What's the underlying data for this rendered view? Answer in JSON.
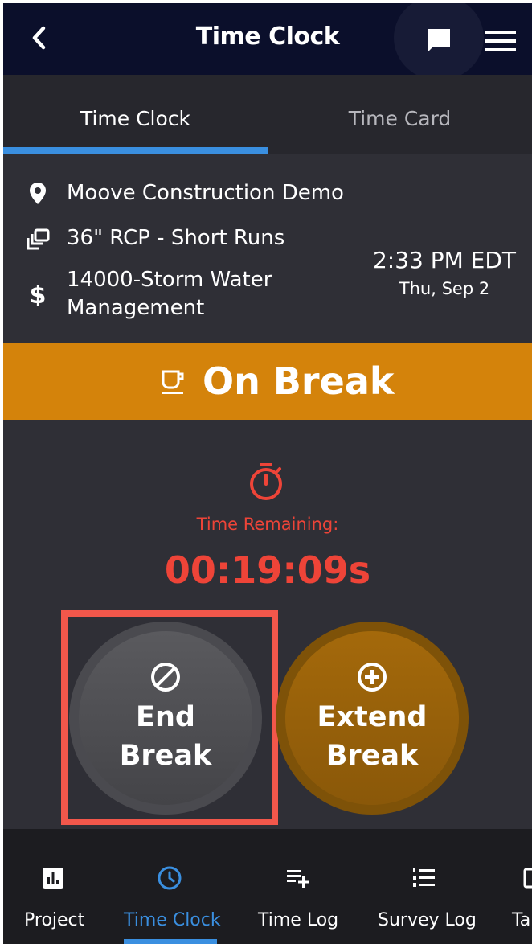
{
  "header": {
    "title": "Time Clock",
    "back_icon": "chevron-left-icon",
    "chat_icon": "chat-icon",
    "menu_icon": "hamburger-menu-icon"
  },
  "tabs": [
    {
      "label": "Time Clock",
      "active": true
    },
    {
      "label": "Time Card",
      "active": false
    }
  ],
  "info": {
    "project": "Moove Construction Demo",
    "task": "36\" RCP - Short Runs",
    "cost_code_line1": "14000-Storm Water",
    "cost_code_line2": "Management",
    "time": "2:33 PM EDT",
    "date": "Thu, Sep 2"
  },
  "status": {
    "label": "On Break",
    "icon": "coffee-cup-icon",
    "color": "#d4830b"
  },
  "timer": {
    "icon": "stopwatch-icon",
    "label": "Time Remaining:",
    "value": "00:19:09s",
    "color": "#ee4438"
  },
  "actions": {
    "end_break": {
      "line1": "End",
      "line2": "Break",
      "icon": "block-icon"
    },
    "extend_break": {
      "line1": "Extend",
      "line2": "Break",
      "icon": "plus-circle-icon"
    }
  },
  "bottom_nav": [
    {
      "label": "Project",
      "icon": "chart-icon",
      "active": false
    },
    {
      "label": "Time Clock",
      "icon": "clock-icon",
      "active": true
    },
    {
      "label": "Time Log",
      "icon": "playlist-add-icon",
      "active": false
    },
    {
      "label": "Survey Log",
      "icon": "numbered-list-icon",
      "active": false
    },
    {
      "label": "Ta",
      "icon": "task-icon",
      "active": false
    }
  ],
  "colors": {
    "accent": "#3a8fe0",
    "header_bg": "#0b0f2b",
    "highlight": "#f2574b"
  }
}
